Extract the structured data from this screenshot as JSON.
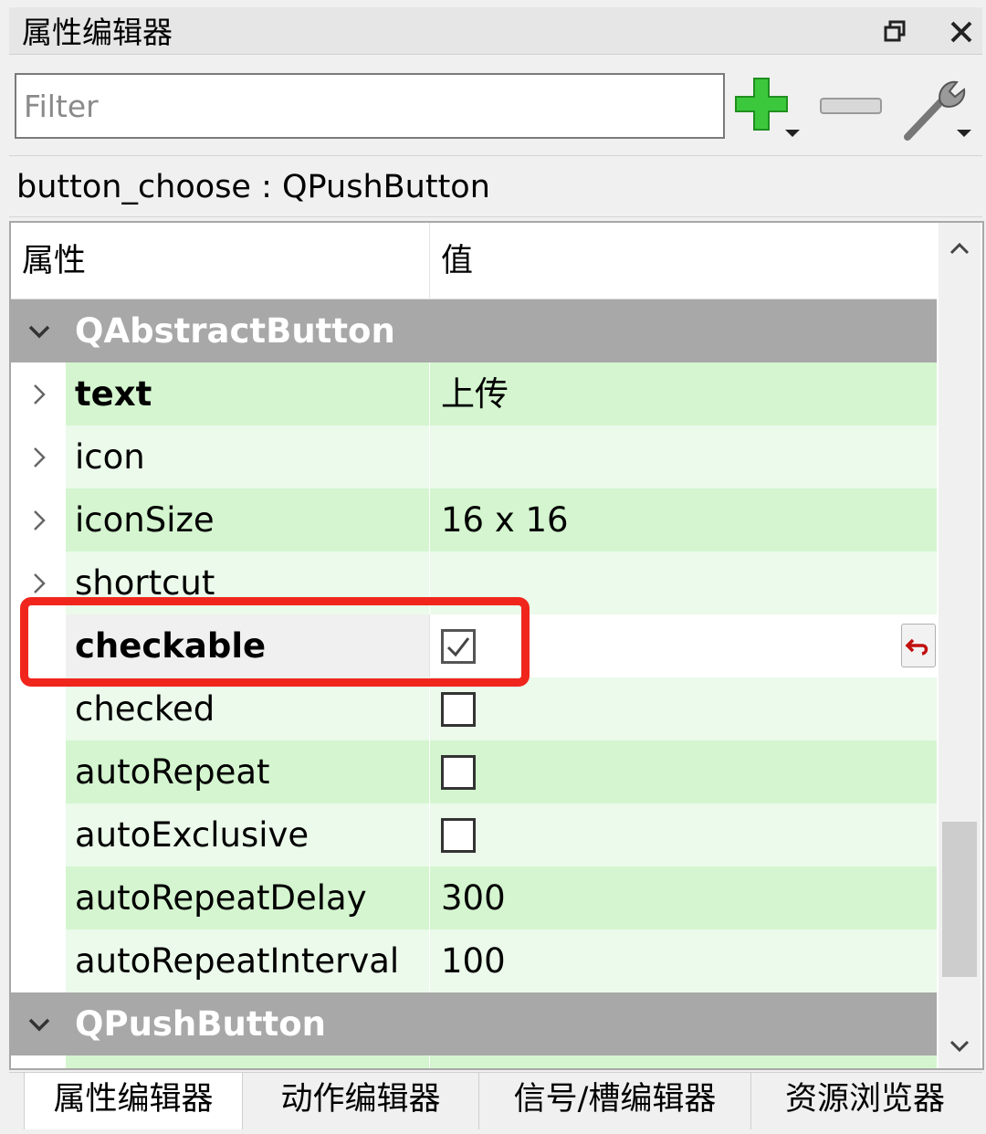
{
  "window": {
    "title": "属性编辑器"
  },
  "filter": {
    "placeholder": "Filter",
    "value": ""
  },
  "object": {
    "label": "button_choose : QPushButton"
  },
  "columns": {
    "property": "属性",
    "value": "值"
  },
  "groups": [
    {
      "label": "QAbstractButton"
    },
    {
      "label": "QPushButton"
    }
  ],
  "properties": [
    {
      "name": "text",
      "value": "上传",
      "bold": true
    },
    {
      "name": "icon",
      "value": ""
    },
    {
      "name": "iconSize",
      "value": "16 x 16"
    },
    {
      "name": "shortcut",
      "value": ""
    },
    {
      "name": "checkable",
      "checked": true,
      "bold": true,
      "selected": true
    },
    {
      "name": "checked",
      "checked": false
    },
    {
      "name": "autoRepeat",
      "checked": false
    },
    {
      "name": "autoExclusive",
      "checked": false
    },
    {
      "name": "autoRepeatDelay",
      "value": "300"
    },
    {
      "name": "autoRepeatInterval",
      "value": "100"
    }
  ],
  "tabs": [
    {
      "label": "属性编辑器",
      "active": true
    },
    {
      "label": "动作编辑器"
    },
    {
      "label": "信号/槽编辑器"
    },
    {
      "label": "资源浏览器"
    }
  ],
  "colors": {
    "highlight": "#f0261d",
    "row_green": "#d4f5cf",
    "row_light": "#ebfaea",
    "group_bg": "#a8a8a8",
    "add_icon": "#3cc83c"
  }
}
